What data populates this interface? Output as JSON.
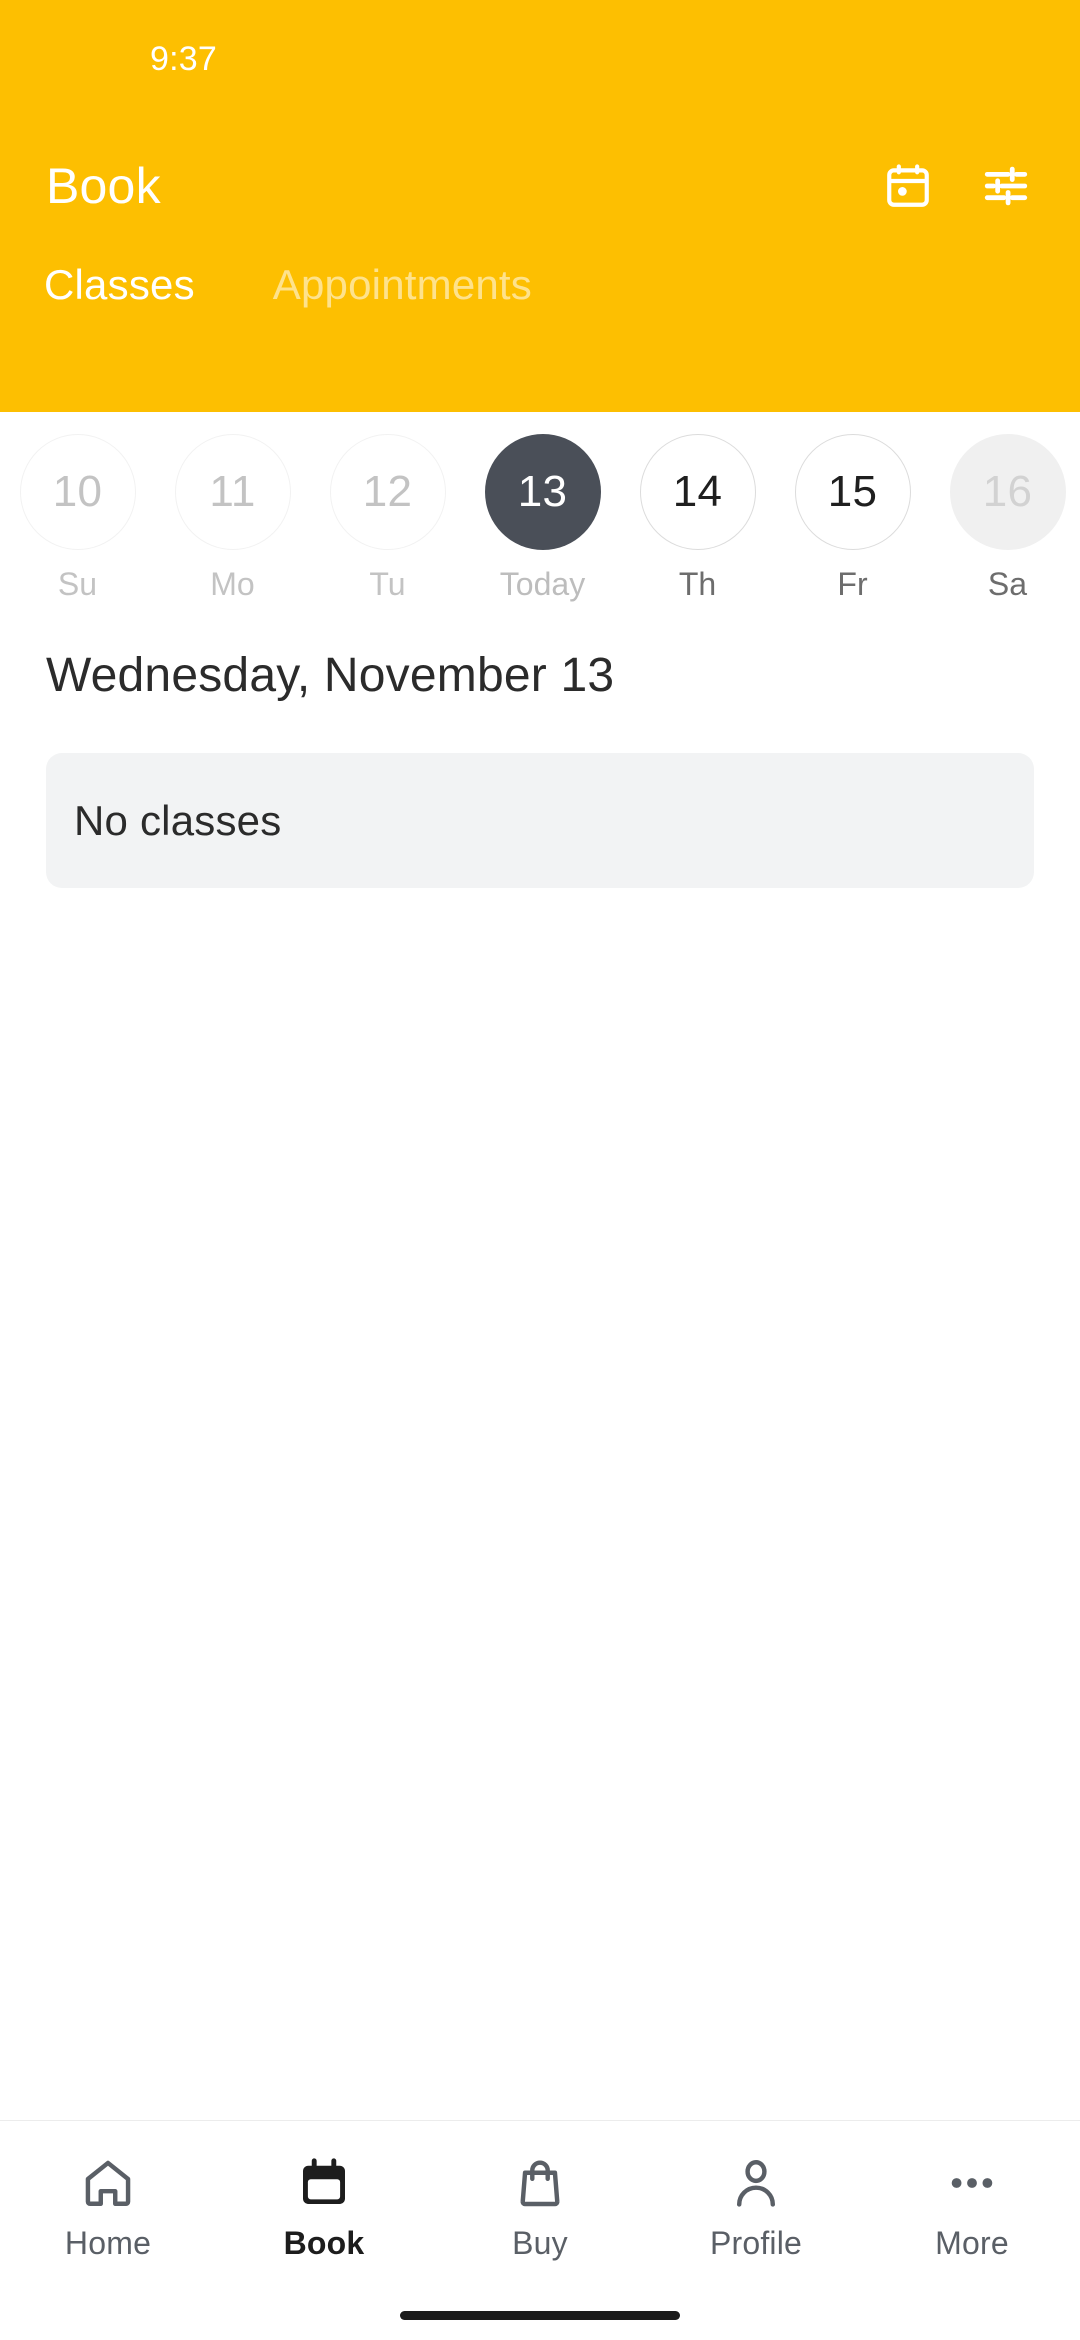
{
  "theme": {
    "brand_yellow": "#FDBF01",
    "selected_dark": "#4A4F58",
    "card_gray": "#F2F3F4"
  },
  "status_bar": {
    "time": "9:37"
  },
  "header": {
    "title": "Book",
    "actions": [
      {
        "name": "calendar-icon",
        "label": "Calendar"
      },
      {
        "name": "filter-icon",
        "label": "Filters"
      }
    ],
    "tabs": [
      {
        "label": "Classes",
        "active": true
      },
      {
        "label": "Appointments",
        "active": false
      }
    ]
  },
  "date_strip": {
    "days": [
      {
        "date": "10",
        "weekday": "Su",
        "state": "past"
      },
      {
        "date": "11",
        "weekday": "Mo",
        "state": "past"
      },
      {
        "date": "12",
        "weekday": "Tu",
        "state": "past"
      },
      {
        "date": "13",
        "weekday": "Today",
        "state": "selected"
      },
      {
        "date": "14",
        "weekday": "Th",
        "state": "available"
      },
      {
        "date": "15",
        "weekday": "Fr",
        "state": "available"
      },
      {
        "date": "16",
        "weekday": "Sa",
        "state": "muted"
      }
    ]
  },
  "main": {
    "date_heading": "Wednesday, November 13",
    "empty_state": "No classes"
  },
  "bottom_nav": {
    "items": [
      {
        "label": "Home",
        "icon": "home-icon",
        "active": false
      },
      {
        "label": "Book",
        "icon": "calendar-filled-icon",
        "active": true
      },
      {
        "label": "Buy",
        "icon": "shopping-bag-icon",
        "active": false
      },
      {
        "label": "Profile",
        "icon": "person-icon",
        "active": false
      },
      {
        "label": "More",
        "icon": "ellipsis-icon",
        "active": false
      }
    ]
  }
}
